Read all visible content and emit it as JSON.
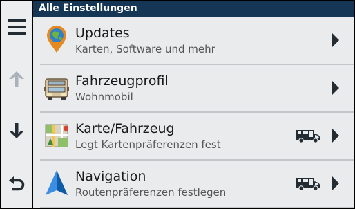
{
  "header": {
    "title": "Alle Einstellungen"
  },
  "sidebar": [
    {
      "name": "menu-button",
      "icon": "hamburger-menu-icon"
    },
    {
      "name": "scroll-up-button",
      "icon": "arrow-up-icon"
    },
    {
      "name": "scroll-down-button",
      "icon": "arrow-down-icon"
    },
    {
      "name": "back-button",
      "icon": "back-arrow-icon"
    }
  ],
  "settings": [
    {
      "title": "Updates",
      "subtitle": "Karten, Software und mehr",
      "icon": "globe-pin-icon",
      "has_vehicle_badge": false
    },
    {
      "title": "Fahrzeugprofil",
      "subtitle": "Wohnmobil",
      "icon": "rv-front-icon",
      "has_vehicle_badge": false
    },
    {
      "title": "Karte/Fahrzeug",
      "subtitle": "Legt Kartenpräferenzen fest",
      "icon": "map-icon",
      "has_vehicle_badge": true
    },
    {
      "title": "Navigation",
      "subtitle": "Routenpräferenzen festlegen",
      "icon": "navigation-arrow-icon",
      "has_vehicle_badge": true
    }
  ],
  "colors": {
    "header_bg": "#163656",
    "list_bg": "#e9ebec",
    "sidebar_bg": "#ecedee",
    "nav_icon_gray": "#232c33",
    "disabled_arrow": "#a9b2b8"
  }
}
